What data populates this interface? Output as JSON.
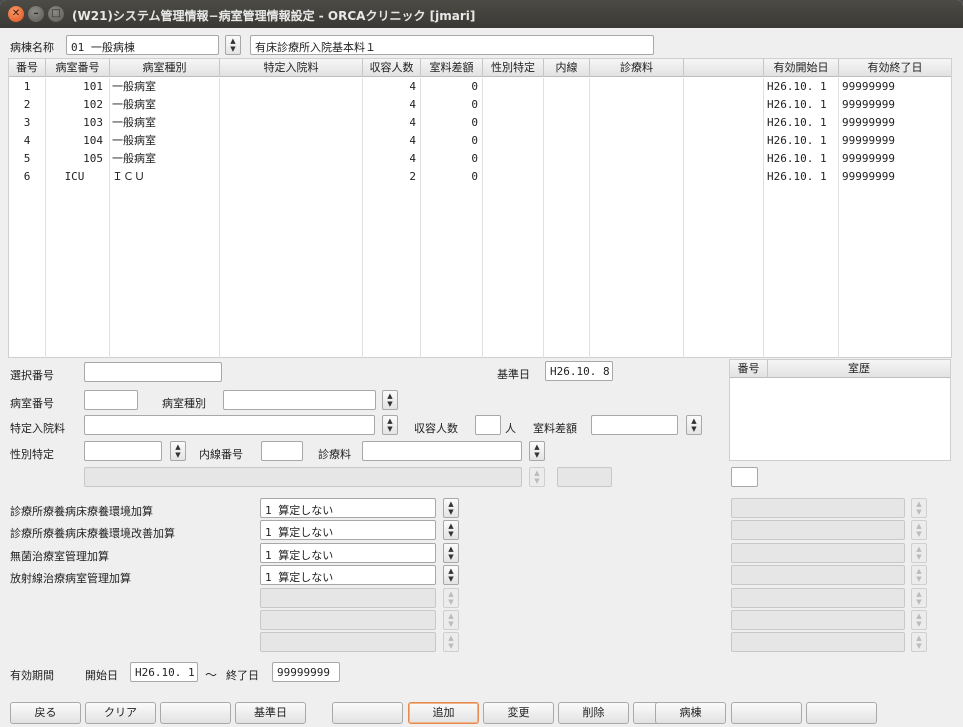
{
  "window": {
    "title": "(W21)システム管理情報−病室管理情報設定 - ORCAクリニック [jmari]"
  },
  "ward": {
    "label": "病棟名称",
    "value": "01 一般病棟",
    "fee_value": "有床診療所入院基本料１"
  },
  "table": {
    "headers": [
      "番号",
      "病室番号",
      "病室種別",
      "特定入院料",
      "収容人数",
      "室料差額",
      "性別特定",
      "内線",
      "診療料",
      "",
      "有効開始日",
      "有効終了日"
    ],
    "rows": [
      {
        "no": "1",
        "room": "101",
        "type": "一般病室",
        "special": "",
        "capacity": "4",
        "diff": "0",
        "gender": "",
        "ext": "",
        "dept": "",
        "blank": "",
        "start": "H26.10. 1",
        "end": "99999999"
      },
      {
        "no": "2",
        "room": "102",
        "type": "一般病室",
        "special": "",
        "capacity": "4",
        "diff": "0",
        "gender": "",
        "ext": "",
        "dept": "",
        "blank": "",
        "start": "H26.10. 1",
        "end": "99999999"
      },
      {
        "no": "3",
        "room": "103",
        "type": "一般病室",
        "special": "",
        "capacity": "4",
        "diff": "0",
        "gender": "",
        "ext": "",
        "dept": "",
        "blank": "",
        "start": "H26.10. 1",
        "end": "99999999"
      },
      {
        "no": "4",
        "room": "104",
        "type": "一般病室",
        "special": "",
        "capacity": "4",
        "diff": "0",
        "gender": "",
        "ext": "",
        "dept": "",
        "blank": "",
        "start": "H26.10. 1",
        "end": "99999999"
      },
      {
        "no": "5",
        "room": "105",
        "type": "一般病室",
        "special": "",
        "capacity": "4",
        "diff": "0",
        "gender": "",
        "ext": "",
        "dept": "",
        "blank": "",
        "start": "H26.10. 1",
        "end": "99999999"
      },
      {
        "no": "6",
        "room": "ICU",
        "type": "ＩＣＵ",
        "special": "",
        "capacity": "2",
        "diff": "0",
        "gender": "",
        "ext": "",
        "dept": "",
        "blank": "",
        "start": "H26.10. 1",
        "end": "99999999"
      }
    ]
  },
  "form": {
    "select_no_label": "選択番号",
    "select_no_value": "",
    "base_date_label": "基準日",
    "base_date_value": "H26.10. 8",
    "room_no_label": "病室番号",
    "room_no_value": "",
    "room_type_label": "病室種別",
    "room_type_value": "",
    "special_label": "特定入院料",
    "special_value": "",
    "capacity_label": "収容人数",
    "capacity_value": "",
    "capacity_unit": "人",
    "diff_label": "室料差額",
    "diff_value": "",
    "gender_label": "性別特定",
    "gender_value": "",
    "ext_label": "内線番号",
    "ext_value": "",
    "dept_label": "診療料",
    "dept_value": ""
  },
  "history": {
    "headers": [
      "番号",
      "室歴"
    ],
    "input_value": ""
  },
  "additions": [
    {
      "label": "診療所療養病床療養環境加算",
      "value": "1 算定しない"
    },
    {
      "label": "診療所療養病床療養環境改善加算",
      "value": "1 算定しない"
    },
    {
      "label": "無菌治療室管理加算",
      "value": "1 算定しない"
    },
    {
      "label": "放射線治療病室管理加算",
      "value": "1 算定しない"
    }
  ],
  "period": {
    "label": "有効期間",
    "start_label": "開始日",
    "start_value": "H26.10. 1",
    "tilde": "〜",
    "end_label": "終了日",
    "end_value": "99999999"
  },
  "buttons": [
    "戻る",
    "クリア",
    "",
    "基準日",
    "",
    "追加",
    "変更",
    "削除",
    "",
    "病棟",
    "",
    ""
  ],
  "colors": {
    "titlebar": "#3f3e3a",
    "background": "#efefef",
    "focus": "#e38b4e"
  }
}
